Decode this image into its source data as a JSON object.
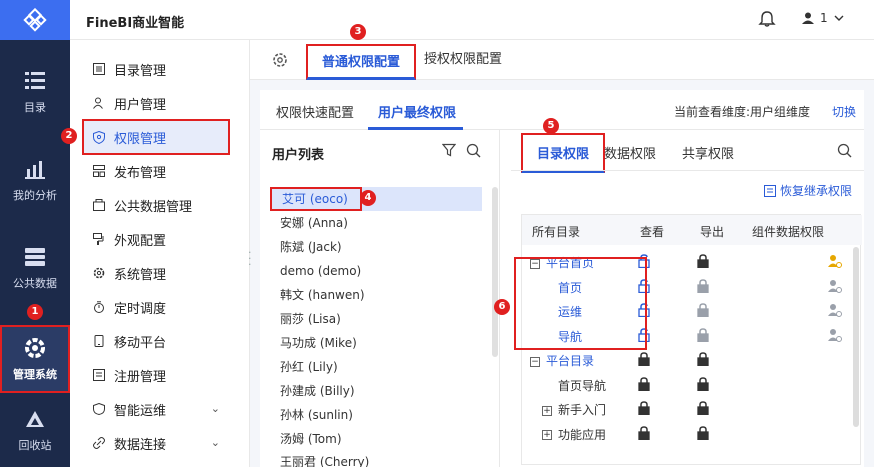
{
  "rail": {
    "items": [
      {
        "label": "目录",
        "icon": "catalog-icon"
      },
      {
        "label": "我的分析",
        "icon": "analysis-icon"
      },
      {
        "label": "公共数据",
        "icon": "database-icon"
      },
      {
        "label": "管理系统",
        "icon": "gear-icon"
      },
      {
        "label": "回收站",
        "icon": "recycle-icon"
      }
    ]
  },
  "header": {
    "brand": "FineBI商业智能",
    "user_label": "1"
  },
  "menu": {
    "items": [
      {
        "label": "目录管理",
        "icon": "list-icon"
      },
      {
        "label": "用户管理",
        "icon": "user-icon"
      },
      {
        "label": "权限管理",
        "icon": "shield-icon"
      },
      {
        "label": "发布管理",
        "icon": "publish-icon"
      },
      {
        "label": "公共数据管理",
        "icon": "box-icon"
      },
      {
        "label": "外观配置",
        "icon": "palette-icon"
      },
      {
        "label": "系统管理",
        "icon": "gear-icon"
      },
      {
        "label": "定时调度",
        "icon": "timer-icon"
      },
      {
        "label": "移动平台",
        "icon": "mobile-icon"
      },
      {
        "label": "注册管理",
        "icon": "register-icon"
      },
      {
        "label": "智能运维",
        "icon": "ops-icon"
      },
      {
        "label": "数据连接",
        "icon": "link-icon"
      }
    ]
  },
  "tabs": {
    "normal": "普通权限配置",
    "grant": "授权权限配置"
  },
  "subtabs": {
    "quick": "权限快速配置",
    "final": "用户最终权限",
    "dimension": "当前查看维度:用户组维度",
    "switch": "切换"
  },
  "userlist": {
    "title": "用户列表",
    "users": [
      "艾可 (eoco)",
      "安娜 (Anna)",
      "陈斌 (Jack)",
      "demo (demo)",
      "韩文 (hanwen)",
      "丽莎 (Lisa)",
      "马功成 (Mike)",
      "孙红 (Lily)",
      "孙建成 (Billy)",
      "孙林 (sunlin)",
      "汤姆 (Tom)",
      "王丽君 (Cherry)"
    ]
  },
  "perm": {
    "tabs": [
      "目录权限",
      "数据权限",
      "共享权限"
    ],
    "restore": "恢复继承权限",
    "headers": {
      "all": "所有目录",
      "view": "查看",
      "export": "导出",
      "widget": "组件数据权限"
    },
    "rows": [
      {
        "name": "平台首页",
        "toggle": "−",
        "indent": 0,
        "blue": true,
        "view": "open",
        "export": "closed",
        "widget": "user-gold"
      },
      {
        "name": "首页",
        "toggle": "",
        "indent": 1,
        "blue": true,
        "view": "open",
        "export": "grey",
        "widget": "user-grey"
      },
      {
        "name": "运维",
        "toggle": "",
        "indent": 1,
        "blue": true,
        "view": "open",
        "export": "grey",
        "widget": "user-grey"
      },
      {
        "name": "导航",
        "toggle": "",
        "indent": 1,
        "blue": true,
        "view": "open",
        "export": "grey",
        "widget": "user-grey"
      },
      {
        "name": "平台目录",
        "toggle": "−",
        "indent": 0,
        "blue": true,
        "view": "closed",
        "export": "closed",
        "widget": ""
      },
      {
        "name": "首页导航",
        "toggle": "",
        "indent": 1,
        "blue": false,
        "view": "closed",
        "export": "closed",
        "widget": ""
      },
      {
        "name": "新手入门",
        "toggle": "+",
        "indent": 1,
        "blue": false,
        "view": "closed",
        "export": "closed",
        "widget": ""
      },
      {
        "name": "功能应用",
        "toggle": "+",
        "indent": 1,
        "blue": false,
        "view": "closed",
        "export": "closed",
        "widget": ""
      }
    ]
  },
  "badges": [
    "1",
    "2",
    "3",
    "4",
    "5",
    "6"
  ],
  "colors": {
    "accent": "#2a5bd7",
    "highlight": "#e02020",
    "rail_bg": "#1c2a4a"
  }
}
